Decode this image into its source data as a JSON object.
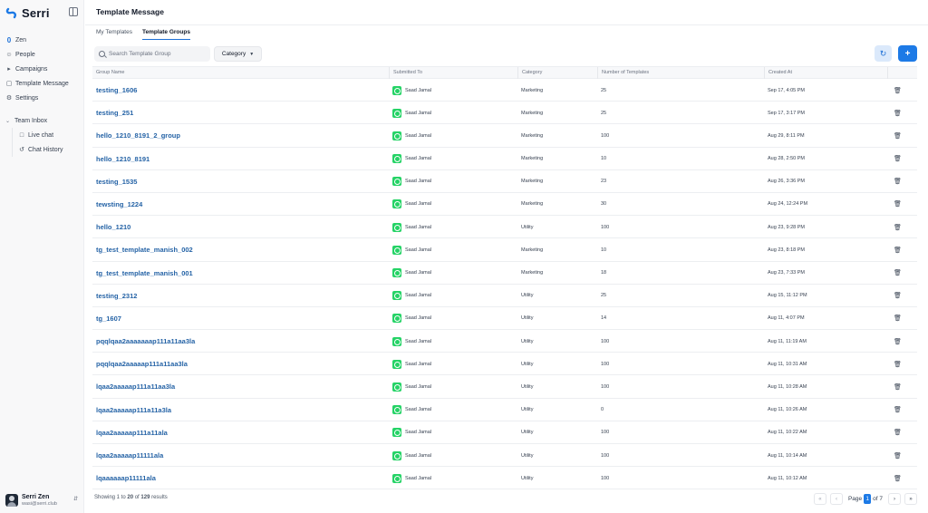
{
  "sidebar": {
    "logo_text": "Serri",
    "nav": [
      {
        "label": "Zen",
        "icon": "zen-icon"
      },
      {
        "label": "People",
        "icon": "people-icon"
      },
      {
        "label": "Campaigns",
        "icon": "megaphone-icon"
      },
      {
        "label": "Template Message",
        "icon": "message-template-icon"
      },
      {
        "label": "Settings",
        "icon": "gear-icon"
      }
    ],
    "team_inbox": {
      "label": "Team Inbox",
      "items": [
        {
          "label": "Live chat",
          "icon": "live-chat-icon"
        },
        {
          "label": "Chat History",
          "icon": "history-icon"
        }
      ]
    },
    "user": {
      "name": "Serri Zen",
      "email": "wasi@serri.club"
    }
  },
  "header": {
    "title": "Template Message"
  },
  "tabs": [
    {
      "label": "My Templates",
      "active": false
    },
    {
      "label": "Template Groups",
      "active": true
    }
  ],
  "toolbar": {
    "search_placeholder": "Search Template Group",
    "category_label": "Category"
  },
  "table": {
    "columns": [
      "Group Name",
      "Submitted To",
      "Category",
      "Number of Templates",
      "Created At"
    ],
    "rows": [
      {
        "name": "testing_1606",
        "submitted_to": "Saad Jamal",
        "category": "Marketing",
        "count": "25",
        "created": "Sep 17, 4:05 PM"
      },
      {
        "name": "testing_251",
        "submitted_to": "Saad Jamal",
        "category": "Marketing",
        "count": "25",
        "created": "Sep 17, 3:17 PM"
      },
      {
        "name": "hello_1210_8191_2_group",
        "submitted_to": "Saad Jamal",
        "category": "Marketing",
        "count": "100",
        "created": "Aug 29, 8:11 PM"
      },
      {
        "name": "hello_1210_8191",
        "submitted_to": "Saad Jamal",
        "category": "Marketing",
        "count": "10",
        "created": "Aug 28, 2:50 PM"
      },
      {
        "name": "testing_1535",
        "submitted_to": "Saad Jamal",
        "category": "Marketing",
        "count": "23",
        "created": "Aug 26, 3:36 PM"
      },
      {
        "name": "tewsting_1224",
        "submitted_to": "Saad Jamal",
        "category": "Marketing",
        "count": "30",
        "created": "Aug 24, 12:24 PM"
      },
      {
        "name": "hello_1210",
        "submitted_to": "Saad Jamal",
        "category": "Utility",
        "count": "100",
        "created": "Aug 23, 9:28 PM"
      },
      {
        "name": "tg_test_template_manish_002",
        "submitted_to": "Saad Jamal",
        "category": "Marketing",
        "count": "10",
        "created": "Aug 23, 8:18 PM"
      },
      {
        "name": "tg_test_template_manish_001",
        "submitted_to": "Saad Jamal",
        "category": "Marketing",
        "count": "18",
        "created": "Aug 23, 7:33 PM"
      },
      {
        "name": "testing_2312",
        "submitted_to": "Saad Jamal",
        "category": "Utility",
        "count": "25",
        "created": "Aug 15, 11:12 PM"
      },
      {
        "name": "tg_1607",
        "submitted_to": "Saad Jamal",
        "category": "Utility",
        "count": "14",
        "created": "Aug 11, 4:07 PM"
      },
      {
        "name": "pqqlqaa2aaaaaaap111a11aa3la",
        "submitted_to": "Saad Jamal",
        "category": "Utility",
        "count": "100",
        "created": "Aug 11, 11:19 AM"
      },
      {
        "name": "pqqlqaa2aaaaap111a11aa3la",
        "submitted_to": "Saad Jamal",
        "category": "Utility",
        "count": "100",
        "created": "Aug 11, 10:31 AM"
      },
      {
        "name": "lqaa2aaaaap111a11aa3la",
        "submitted_to": "Saad Jamal",
        "category": "Utility",
        "count": "100",
        "created": "Aug 11, 10:28 AM"
      },
      {
        "name": "lqaa2aaaaap111a11a3la",
        "submitted_to": "Saad Jamal",
        "category": "Utility",
        "count": "0",
        "created": "Aug 11, 10:26 AM"
      },
      {
        "name": "lqaa2aaaaap111a11ala",
        "submitted_to": "Saad Jamal",
        "category": "Utility",
        "count": "100",
        "created": "Aug 11, 10:22 AM"
      },
      {
        "name": "lqaa2aaaaap11111ala",
        "submitted_to": "Saad Jamal",
        "category": "Utility",
        "count": "100",
        "created": "Aug 11, 10:14 AM"
      },
      {
        "name": "lqaaaaaap11111ala",
        "submitted_to": "Saad Jamal",
        "category": "Utility",
        "count": "100",
        "created": "Aug 11, 10:12 AM"
      }
    ]
  },
  "footer": {
    "showing_prefix": "Showing 1 to ",
    "showing_shown": "20",
    "showing_mid": " of ",
    "showing_total": "129",
    "showing_suffix": " results",
    "page_label": "Page",
    "page_current": "1",
    "page_of": "of 7"
  },
  "colors": {
    "accent": "#1d7ae6",
    "link": "#2563a6",
    "whatsapp": "#25d366"
  }
}
